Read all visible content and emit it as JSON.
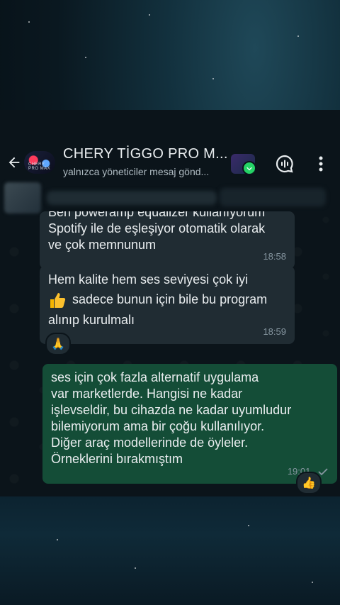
{
  "header": {
    "group_name": "CHERY TİGGO PRO M...",
    "subtitle": "yalnızca yöneticiler mesaj gönd...",
    "avatar_text": "CHERY PRO MAX"
  },
  "messages": [
    {
      "direction": "incoming",
      "lines": [
        "Ben poweramp equalizer kullanıyorum",
        "Spotify ile de eşleşiyor otomatik olarak",
        "ve çok memnunum"
      ],
      "time": "18:58"
    },
    {
      "direction": "incoming",
      "lines": [
        "Hem kalite hem ses seviyesi çok iyi",
        "sadece bunun için bile bu program",
        "alınıp kurulmalı"
      ],
      "time": "18:59",
      "reaction": "🙏"
    },
    {
      "direction": "outgoing",
      "lines": [
        "ses için çok fazla alternatif uygulama",
        "var marketlerde. Hangisi ne kadar",
        "işlevseldir, bu cihazda ne kadar uyumludur",
        "bilemiyorum ama bir çoğu kullanılıyor.",
        "Diğer araç modellerinde de öyleler.",
        "Örneklerini bırakmıştım"
      ],
      "time": "19:01",
      "reaction": "👍"
    }
  ],
  "colors": {
    "incoming_bubble": "#202c33",
    "outgoing_bubble": "#144d37",
    "background": "#0b141a",
    "secondary_text": "#8696a0"
  }
}
